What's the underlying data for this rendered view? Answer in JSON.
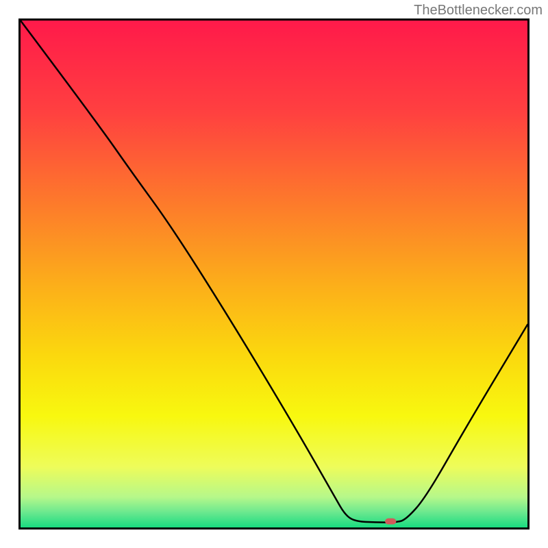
{
  "watermark": "TheBottlenecker.com",
  "chart_data": {
    "type": "line",
    "title": "",
    "xlabel": "",
    "ylabel": "",
    "xlim": [
      0,
      100
    ],
    "ylim": [
      0,
      100
    ],
    "gradient_stops": [
      {
        "offset": 0,
        "color": "#ff1a4a"
      },
      {
        "offset": 18,
        "color": "#ff4040"
      },
      {
        "offset": 36,
        "color": "#fd7a2b"
      },
      {
        "offset": 52,
        "color": "#fcae1a"
      },
      {
        "offset": 66,
        "color": "#fbd80e"
      },
      {
        "offset": 78,
        "color": "#f8f80f"
      },
      {
        "offset": 88,
        "color": "#eefc5a"
      },
      {
        "offset": 94,
        "color": "#b6f88a"
      },
      {
        "offset": 97,
        "color": "#6be88f"
      },
      {
        "offset": 100,
        "color": "#19db80"
      }
    ],
    "curve": [
      {
        "x": 0.0,
        "y": 100.0
      },
      {
        "x": 15.0,
        "y": 80.0
      },
      {
        "x": 22.0,
        "y": 70.0
      },
      {
        "x": 30.0,
        "y": 59.0
      },
      {
        "x": 42.0,
        "y": 40.0
      },
      {
        "x": 54.0,
        "y": 20.0
      },
      {
        "x": 62.0,
        "y": 6.0
      },
      {
        "x": 64.0,
        "y": 2.5
      },
      {
        "x": 66.0,
        "y": 1.2
      },
      {
        "x": 70.0,
        "y": 1.0
      },
      {
        "x": 74.0,
        "y": 1.0
      },
      {
        "x": 76.0,
        "y": 1.5
      },
      {
        "x": 80.0,
        "y": 6.0
      },
      {
        "x": 88.0,
        "y": 20.0
      },
      {
        "x": 100.0,
        "y": 40.0
      }
    ],
    "marker": {
      "x": 73.0,
      "y": 1.2,
      "width_pct": 2.2,
      "height_pct": 1.2,
      "color": "#d15a5a"
    }
  }
}
